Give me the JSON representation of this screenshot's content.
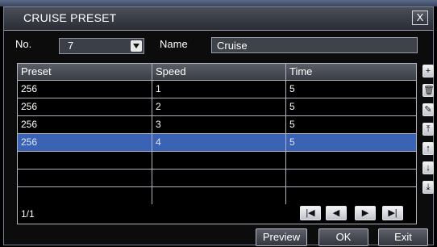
{
  "window": {
    "title": "CRUISE PRESET",
    "close_label": "X"
  },
  "form": {
    "no_label": "No.",
    "no_value": "7",
    "name_label": "Name",
    "name_value": "Cruise"
  },
  "table": {
    "columns": [
      "Preset",
      "Speed",
      "Time"
    ],
    "rows": [
      {
        "preset": "256",
        "speed": "1",
        "time": "5",
        "selected": false
      },
      {
        "preset": "256",
        "speed": "2",
        "time": "5",
        "selected": false
      },
      {
        "preset": "256",
        "speed": "3",
        "time": "5",
        "selected": false
      },
      {
        "preset": "256",
        "speed": "4",
        "time": "5",
        "selected": true
      },
      {
        "preset": "",
        "speed": "",
        "time": "",
        "selected": false
      },
      {
        "preset": "",
        "speed": "",
        "time": "",
        "selected": false
      }
    ],
    "page_indicator": "1/1"
  },
  "pager": {
    "first_icon": "first-page-icon",
    "prev_icon": "prev-page-icon",
    "next_icon": "next-page-icon",
    "last_icon": "last-page-icon"
  },
  "side_tools": [
    {
      "name": "add",
      "icon": "plus-icon",
      "glyph": "+"
    },
    {
      "name": "delete",
      "icon": "trash-icon",
      "glyph": "🗑"
    },
    {
      "name": "edit",
      "icon": "pencil-icon",
      "glyph": "✎"
    },
    {
      "name": "move-top",
      "icon": "move-top-icon",
      "glyph": "⤒"
    },
    {
      "name": "move-up",
      "icon": "arrow-up-icon",
      "glyph": "↑"
    },
    {
      "name": "move-down",
      "icon": "arrow-down-icon",
      "glyph": "↓"
    },
    {
      "name": "move-bottom",
      "icon": "move-bottom-icon",
      "glyph": "⤓"
    }
  ],
  "buttons": {
    "preview": "Preview",
    "ok": "OK",
    "exit": "Exit"
  },
  "colors": {
    "selection": "#3a63b6",
    "background": "#000000"
  }
}
